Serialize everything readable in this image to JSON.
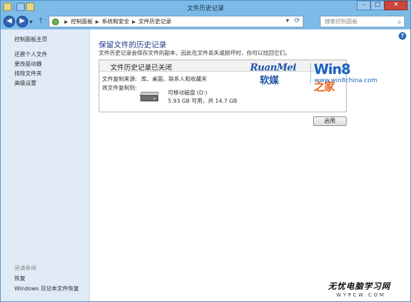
{
  "window": {
    "title": "文件历史记录",
    "min_label": "–",
    "max_label": "□",
    "close_label": "✕"
  },
  "address": {
    "crumbs": [
      "控制面板",
      "系统和安全",
      "文件历史记录"
    ],
    "separator": "▶",
    "search_placeholder": "搜索控制面板"
  },
  "sidebar": {
    "home": "控制面板主页",
    "links": [
      "还原个人文件",
      "更改驱动器",
      "排除文件夹",
      "高级设置"
    ],
    "see_also_title": "另请参阅",
    "see_also": [
      "恢复",
      "Windows 日记本文件恢复"
    ]
  },
  "main": {
    "heading": "保留文件的历史记录",
    "description": "文件历史记录会保存文件的副本，因此在文件丢失或损坏时，你可以找回它们。",
    "panel_title": "文件历史记录已关闭",
    "source_label": "文件复制来源:",
    "source_value": "库、桌面、联系人和收藏夹",
    "dest_label": "将文件复制到:",
    "drive_name": "可移动磁盘 (D:)",
    "drive_space": "5.93 GB 可用，共 14.7 GB",
    "enable_button": "启用",
    "help_label": "?"
  },
  "watermark": {
    "brand_en": "RuanMei",
    "brand_cn": "软媒",
    "product": "Win8",
    "product_cn": "之家",
    "url": "www.win8china.com"
  },
  "site_logo": {
    "cn": "无忧电脑学习网",
    "en": "WYPCW.COM"
  },
  "colors": {
    "frame": "#7cbbe8",
    "sidebar_bg": "#e1ebf7",
    "heading": "#1e3a8a",
    "close_button": "#c9473d"
  },
  "icons": {
    "back": "back-arrow-icon",
    "forward": "forward-arrow-icon",
    "up": "up-arrow-icon",
    "refresh": "refresh-icon",
    "search": "search-icon",
    "help": "help-icon",
    "drive": "removable-drive-icon"
  }
}
